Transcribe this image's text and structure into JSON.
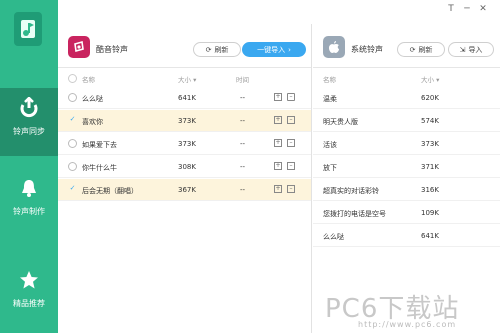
{
  "sidebar": {
    "items": [
      {
        "label": "铃声同步",
        "icon": "sync-arrow-icon"
      },
      {
        "label": "铃声制作",
        "icon": "bell-icon"
      },
      {
        "label": "精品推荐",
        "icon": "star-icon"
      }
    ]
  },
  "window": {
    "skin": "T",
    "minimize": "─",
    "close": "✕"
  },
  "left_panel": {
    "title": "酷音铃声",
    "refresh_label": "刷新",
    "import_label": "一键导入",
    "columns": {
      "name": "名称",
      "size": "大小 ▾",
      "time": "时间"
    },
    "rows": [
      {
        "name": "么么哒",
        "size": "641K",
        "time": "--",
        "selected": false
      },
      {
        "name": "喜欢你",
        "size": "373K",
        "time": "--",
        "selected": true
      },
      {
        "name": "如果爱下去",
        "size": "373K",
        "time": "--",
        "selected": false
      },
      {
        "name": "你牛什么牛",
        "size": "308K",
        "time": "--",
        "selected": false
      },
      {
        "name": "后会无期（翻唱）",
        "size": "367K",
        "time": "--",
        "selected": true
      }
    ]
  },
  "right_panel": {
    "title": "系统铃声",
    "refresh_label": "刷新",
    "import_label": "导入",
    "columns": {
      "name": "名称",
      "size": "大小 ▾"
    },
    "rows": [
      {
        "name": "温柔",
        "size": "620K"
      },
      {
        "name": "明天贵人版",
        "size": "574K"
      },
      {
        "name": "活该",
        "size": "373K"
      },
      {
        "name": "放下",
        "size": "371K"
      },
      {
        "name": "超真实的对话彩铃",
        "size": "316K"
      },
      {
        "name": "您拨打的电话是空号",
        "size": "109K"
      },
      {
        "name": "么么哒",
        "size": "641K"
      }
    ]
  },
  "watermark": {
    "text": "PC6下载站",
    "url": "http://www.pc6.com"
  },
  "colors": {
    "sidebar": "#2fb98c",
    "accent": "#3aa8f0",
    "selected_row": "#fdf4dc"
  }
}
